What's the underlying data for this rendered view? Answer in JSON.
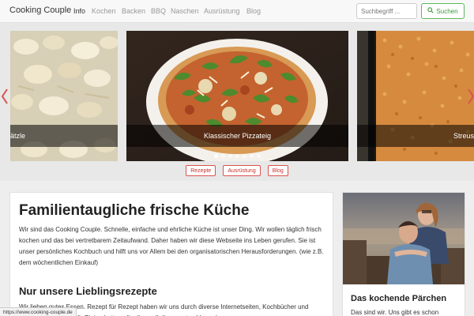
{
  "navbar": {
    "brand": "Cooking Couple",
    "items": [
      {
        "label": "Info",
        "active": true
      },
      {
        "label": "Kochen",
        "active": false
      },
      {
        "label": "Backen",
        "active": false
      },
      {
        "label": "BBQ",
        "active": false
      },
      {
        "label": "Naschen",
        "active": false
      },
      {
        "label": "Ausrüstung",
        "active": false
      },
      {
        "label": "Blog",
        "active": false
      }
    ],
    "search_placeholder": "Suchbegriff ...",
    "search_button": "Suchen",
    "search_icon": "search-icon"
  },
  "carousel": {
    "slides": [
      {
        "caption": "ätzle"
      },
      {
        "caption": "Klassischer Pizzateig"
      },
      {
        "caption": "Streus"
      }
    ],
    "dots": 7,
    "active_dot": 0,
    "prev_icon": "chevron-left-icon",
    "next_icon": "chevron-right-icon",
    "arrow_color": "#d9534f"
  },
  "quick_links": [
    "Rezepte",
    "Ausrüstung",
    "Blog"
  ],
  "main": {
    "title": "Familientaugliche frische Küche",
    "intro": "Wir sind das Cooking Couple. Schnelle, einfache und ehrliche Küche ist unser Ding. Wir wollen täglich frisch kochen und das bei vertretbarem Zeitaufwand. Daher haben wir diese Webseite ins Leben gerufen. Sie ist unser persönliches Kochbuch und hilft uns vor Allem bei den organisatorischen Herausforderungen. (wie z.B. dem wöchentlichen Einkauf)",
    "section_title": "Nur unsere Lieblingsrezepte",
    "section_text": "Wir lieben gutes Essen. Rezept für Rezept haben wir uns durch diverse Internetseiten, Kochbücher und Zeitschriften gekämpft. Einige hatten allerdings all diese ersten Versuche"
  },
  "sidebar": {
    "title": "Das kochende Pärchen",
    "text": "Das sind wir. Uns gibt es schon"
  },
  "status_url": "https://www.cooking-couple.de",
  "colors": {
    "accent_green": "#5cb85c",
    "accent_red": "#d9534f",
    "navbar_bg": "#f8f8f8"
  }
}
